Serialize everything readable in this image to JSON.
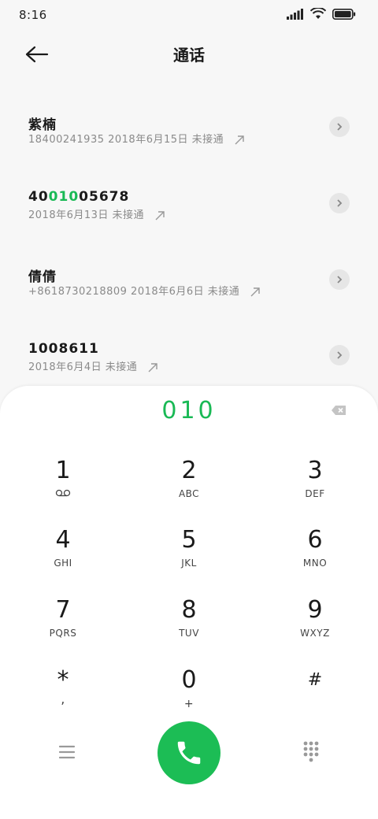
{
  "status_bar": {
    "time": "8:16"
  },
  "header": {
    "title": "通话"
  },
  "calls": [
    {
      "name": "紫楠",
      "detail": "18400241935  2018年6月15日  未接通"
    },
    {
      "name_prefix": "40",
      "name_match": "010",
      "name_suffix": "05678",
      "detail": "2018年6月13日  未接通"
    },
    {
      "name": "倩倩",
      "detail": "+8618730218809  2018年6月6日  未接通"
    },
    {
      "name": "1008611",
      "detail": "2018年6月4日  未接通"
    }
  ],
  "dialpad": {
    "input": "010",
    "keys": [
      {
        "digit": "1",
        "letters": ""
      },
      {
        "digit": "2",
        "letters": "ABC"
      },
      {
        "digit": "3",
        "letters": "DEF"
      },
      {
        "digit": "4",
        "letters": "GHI"
      },
      {
        "digit": "5",
        "letters": "JKL"
      },
      {
        "digit": "6",
        "letters": "MNO"
      },
      {
        "digit": "7",
        "letters": "PQRS"
      },
      {
        "digit": "8",
        "letters": "TUV"
      },
      {
        "digit": "9",
        "letters": "WXYZ"
      },
      {
        "digit": "*",
        "letters": ","
      },
      {
        "digit": "0",
        "letters": "+"
      },
      {
        "digit": "#",
        "letters": ""
      }
    ]
  },
  "colors": {
    "accent": "#1cbd55",
    "info_bg": "#e6e6e6"
  },
  "icons": [
    "back-arrow-icon",
    "missed-call-arrow-icon",
    "chevron-right-icon",
    "voicemail-icon",
    "backspace-icon",
    "menu-icon",
    "phone-icon",
    "keypad-icon"
  ]
}
